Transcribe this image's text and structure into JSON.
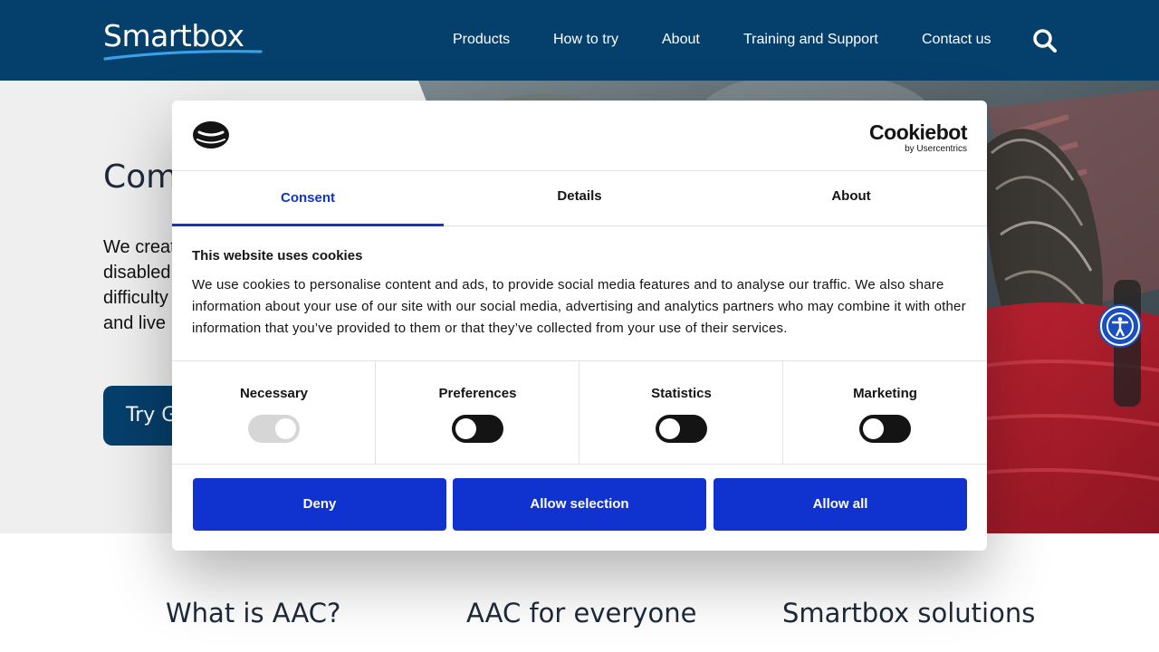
{
  "header": {
    "logo_text": "Smartbox",
    "nav": [
      {
        "label": "Products"
      },
      {
        "label": "How to try"
      },
      {
        "label": "About"
      },
      {
        "label": "Training and Support"
      },
      {
        "label": "Contact us"
      }
    ],
    "search_icon": "search-icon"
  },
  "hero": {
    "heading": "Com",
    "text_lines": [
      "We creat",
      "disabled",
      "difficulty",
      "and live"
    ],
    "cta_label": "Try G"
  },
  "bottom": {
    "titles": [
      "What is AAC?",
      "AAC for everyone",
      "Smartbox solutions"
    ]
  },
  "cookie_dialog": {
    "brand": "Cookiebot",
    "brand_sub": "by Usercentrics",
    "tabs": [
      {
        "label": "Consent",
        "active": true
      },
      {
        "label": "Details",
        "active": false
      },
      {
        "label": "About",
        "active": false
      }
    ],
    "title": "This website uses cookies",
    "body": "We use cookies to personalise content and ads, to provide social media features and to analyse our traffic. We also share information about your use of our site with our social media, advertising and analytics partners who may combine it with other information that you’ve provided to them or that they’ve collected from your use of their services.",
    "toggles": [
      {
        "label": "Necessary",
        "enabled": true,
        "disabled": true
      },
      {
        "label": "Preferences",
        "enabled": false,
        "disabled": false
      },
      {
        "label": "Statistics",
        "enabled": false,
        "disabled": false
      },
      {
        "label": "Marketing",
        "enabled": false,
        "disabled": false
      }
    ],
    "buttons": {
      "deny": "Deny",
      "allow_selection": "Allow selection",
      "allow_all": "Allow all"
    }
  },
  "colors": {
    "header_bg": "#053f6b",
    "accent_blue": "#1032cf",
    "a11y_blue": "#1a4fbf"
  }
}
